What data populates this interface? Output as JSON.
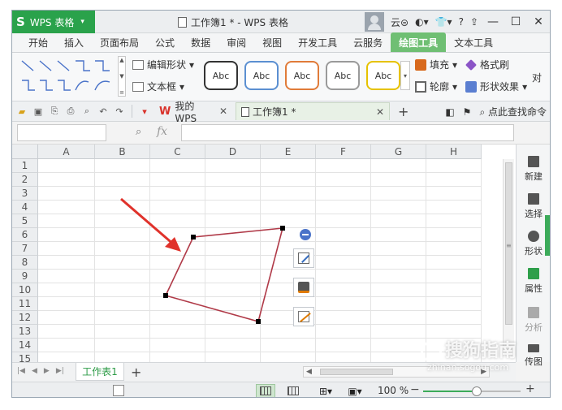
{
  "app": {
    "logo": "S",
    "name": "WPS 表格",
    "caret": "▾"
  },
  "titlebar": {
    "doc_title": "工作簿1 * - WPS 表格",
    "cloud": "云⊜",
    "help": "?",
    "minimize": "—",
    "maximize": "☐",
    "close": "✕"
  },
  "menu_tabs": [
    "开始",
    "插入",
    "页面布局",
    "公式",
    "数据",
    "审阅",
    "视图",
    "开发工具",
    "云服务",
    "绘图工具",
    "文本工具"
  ],
  "active_menu_tab": "绘图工具",
  "ribbon": {
    "edit_shape": "编辑形状",
    "text_box": "文本框",
    "style_presets": [
      {
        "label": "Abc",
        "border": "#333333"
      },
      {
        "label": "Abc",
        "border": "#5b8fd1"
      },
      {
        "label": "Abc",
        "border": "#e07b39"
      },
      {
        "label": "Abc",
        "border": "#9a9a9a"
      },
      {
        "label": "Abc",
        "border": "#e6c200"
      }
    ],
    "fill": "填充",
    "format_brush": "格式刷",
    "outline": "轮廓",
    "shape_effect": "形状效果",
    "cut_text": "对"
  },
  "toolbar": {
    "my_wps": "我的WPS",
    "doc_tab": "工作簿1 *",
    "search_text": "点此查找命令"
  },
  "formula_bar": {
    "fx": "fx",
    "name_box": "",
    "value": ""
  },
  "columns": [
    "A",
    "B",
    "C",
    "D",
    "E",
    "F",
    "G",
    "H"
  ],
  "rows": [
    "1",
    "2",
    "3",
    "4",
    "5",
    "6",
    "7",
    "8",
    "9",
    "10",
    "11",
    "12",
    "13",
    "14",
    "15"
  ],
  "task_pane": {
    "new": "新建",
    "select": "选择",
    "shape": "形状",
    "properties": "属性",
    "analyze": "分析",
    "pass_photo": "传图"
  },
  "sheet_tabs": [
    "工作表1"
  ],
  "status_bar": {
    "zoom": "100 %",
    "zoom_fraction": 0.55
  },
  "watermark": {
    "brand": "搜狗指南",
    "url": "zhinan.sogou.com"
  },
  "colors": {
    "wps_green": "#2aa24b",
    "active_tab": "#6fbf73",
    "shape_stroke": "#b03a48",
    "arrow": "#e0322b"
  }
}
